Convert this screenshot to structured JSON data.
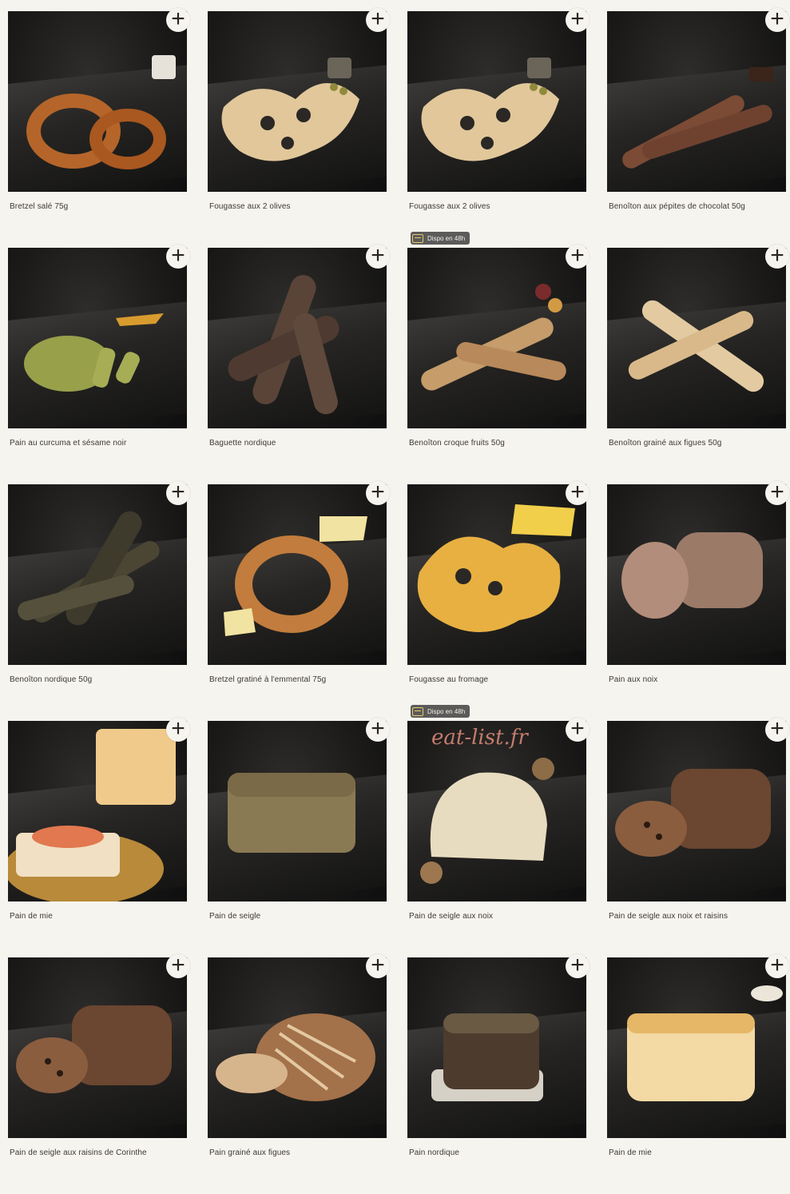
{
  "add_label": "+",
  "badge_label": "Dispo en 48h",
  "watermark": "eat-list.fr",
  "colors": {
    "background": "#f6f4ef",
    "slate": "#262523",
    "watermark": "#e08c7a",
    "text": "#3e3834"
  },
  "products": [
    {
      "name": "Bretzel salé 75g",
      "badge": false,
      "tone": "pretzel"
    },
    {
      "name": "Fougasse aux 2 olives",
      "badge": false,
      "tone": "fougasse"
    },
    {
      "name": "Fougasse aux 2 olives",
      "badge": true,
      "tone": "fougasse"
    },
    {
      "name": "Benoîton aux pépites de chocolat 50g",
      "badge": false,
      "tone": "chocolate"
    },
    {
      "name": "Pain au curcuma et sésame noir",
      "badge": false,
      "tone": "curcuma"
    },
    {
      "name": "Baguette nordique",
      "badge": false,
      "tone": "dark"
    },
    {
      "name": "Benoîton croque fruits 50g",
      "badge": false,
      "tone": "sticks"
    },
    {
      "name": "Benoîton grainé aux figues 50g",
      "badge": false,
      "tone": "sticks-light"
    },
    {
      "name": "Benoîton nordique 50g",
      "badge": false,
      "tone": "seeded"
    },
    {
      "name": "Bretzel gratiné à l'emmental 75g",
      "badge": false,
      "tone": "pretzel-cheese"
    },
    {
      "name": "Fougasse au fromage",
      "badge": true,
      "tone": "cheese-fougasse"
    },
    {
      "name": "Pain aux noix",
      "badge": false,
      "tone": "loaf-walnut"
    },
    {
      "name": "Pain de mie",
      "badge": false,
      "tone": "mie-toast"
    },
    {
      "name": "Pain de seigle",
      "badge": false,
      "tone": "rye"
    },
    {
      "name": "Pain de seigle aux noix",
      "badge": false,
      "tone": "boule-light"
    },
    {
      "name": "Pain de seigle aux noix et raisins",
      "badge": false,
      "tone": "loaf-raisin"
    },
    {
      "name": "Pain de seigle aux raisins de Corinthe",
      "badge": false,
      "tone": "loaf-raisin"
    },
    {
      "name": "Pain grainé aux figues",
      "badge": false,
      "tone": "boule-scored"
    },
    {
      "name": "Pain nordique",
      "badge": false,
      "tone": "nordic"
    },
    {
      "name": "Pain de mie",
      "badge": false,
      "tone": "mie-loaf"
    }
  ]
}
